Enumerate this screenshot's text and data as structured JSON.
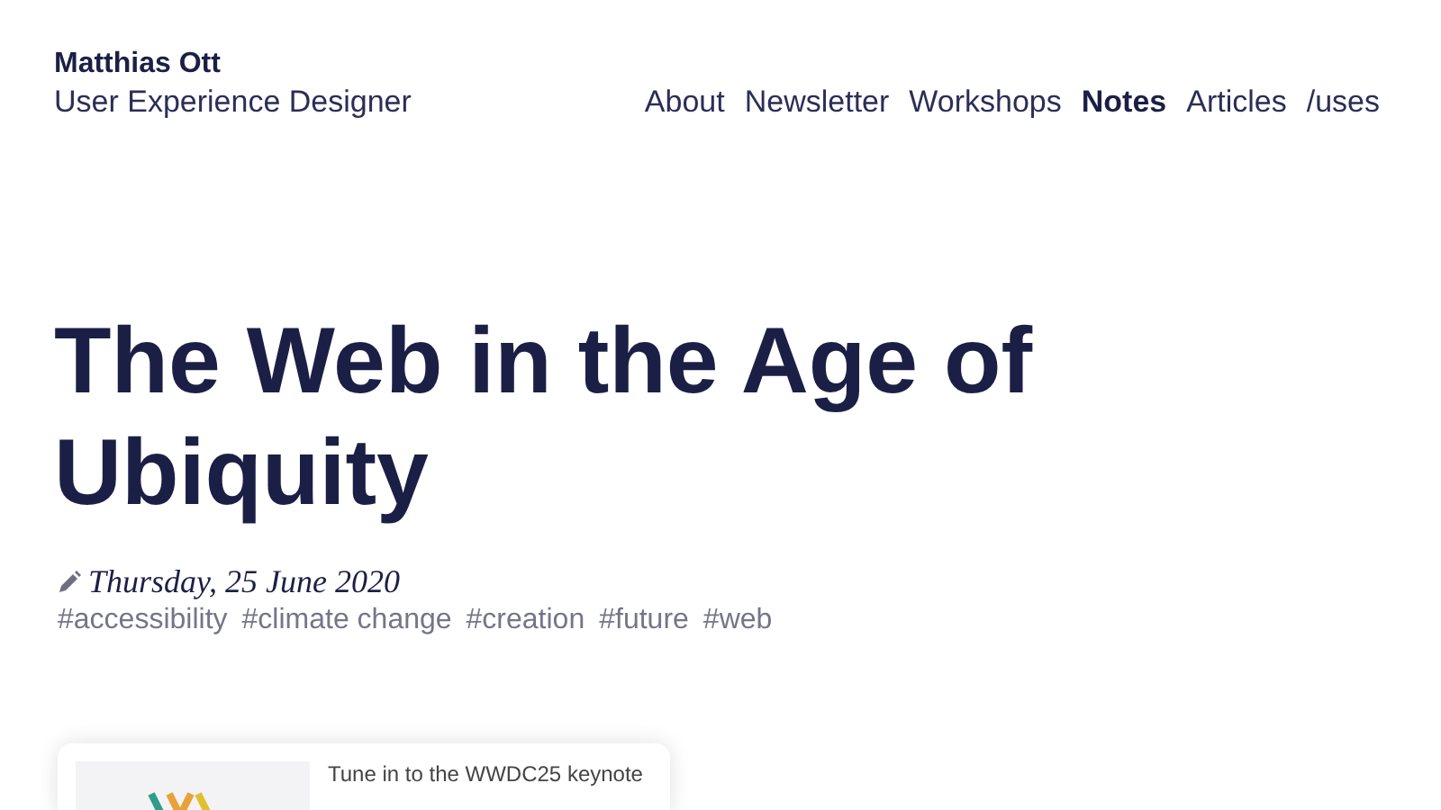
{
  "site": {
    "name": "Matthias Ott",
    "tagline": "User Experience Designer"
  },
  "nav": [
    {
      "label": "About",
      "selected": false
    },
    {
      "label": "Newsletter",
      "selected": false
    },
    {
      "label": "Workshops",
      "selected": false
    },
    {
      "label": "Notes",
      "selected": true
    },
    {
      "label": "Articles",
      "selected": false
    },
    {
      "label": "/uses",
      "selected": false
    }
  ],
  "article": {
    "title": "The Web in the Age of Ubiquity",
    "date": "Thursday, 25 June 2020",
    "tags": [
      "#accessibility",
      "#climate change",
      "#creation",
      "#future",
      "#web"
    ]
  },
  "promo": {
    "text": "Tune in to the WWDC25 keynote"
  }
}
